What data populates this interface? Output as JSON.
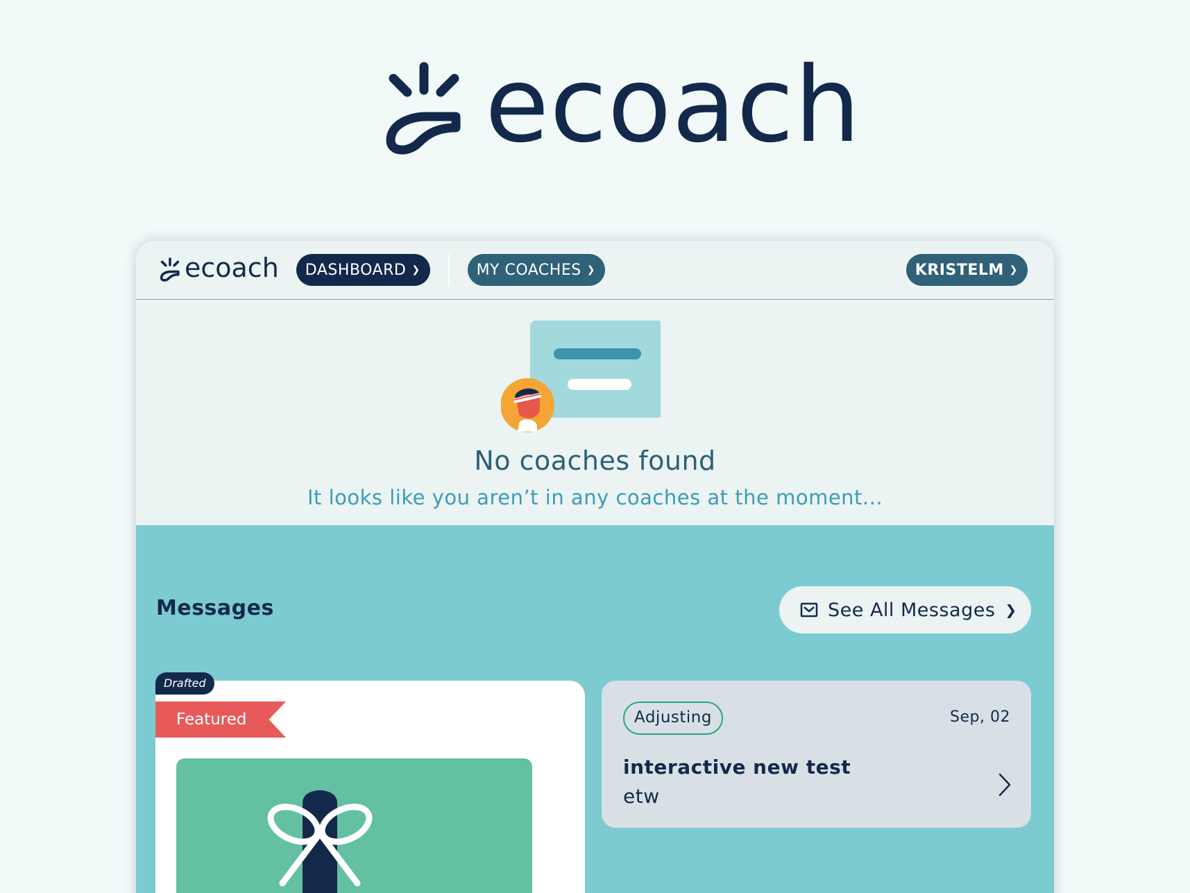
{
  "brand": {
    "name": "ecoach"
  },
  "navbar": {
    "logo_text": "ecoach",
    "dashboard_label": "DASHBOARD",
    "coaches_label": "MY COACHES",
    "user_label": "KRISTELM"
  },
  "empty_state": {
    "title": "No coaches found",
    "subtitle": "It looks like you aren’t in any coaches at the moment..."
  },
  "messages": {
    "heading": "Messages",
    "see_all_label": "See All Messages",
    "featured_card": {
      "draft_badge": "Drafted",
      "ribbon": "Featured"
    },
    "items": [
      {
        "status": "Adjusting",
        "date": "Sep, 02",
        "title": "interactive new test",
        "preview": "etw"
      }
    ]
  },
  "colors": {
    "navy": "#13294b",
    "teal_bg": "#7ccbd0",
    "slate_blue": "#2f6178",
    "featured_red": "#e85a5a",
    "status_green": "#2ea38a",
    "card_green": "#63c0a2"
  },
  "icons": [
    "ecoach-logo-icon",
    "chevron-down-icon",
    "mail-icon",
    "chevron-right-icon",
    "message-card-illustration",
    "coach-avatar-icon",
    "gift-bow-icon"
  ]
}
